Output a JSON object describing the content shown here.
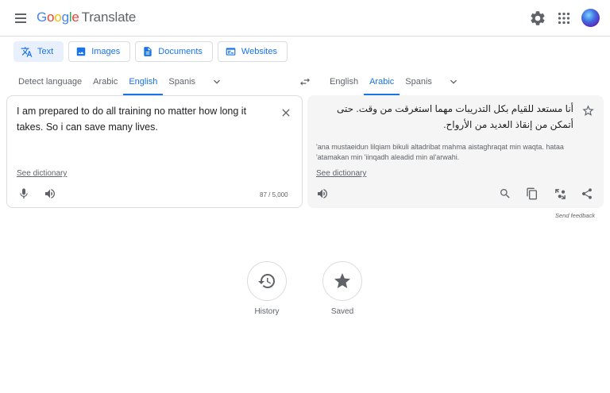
{
  "header": {
    "logo_google": "Google",
    "logo_product": "Translate",
    "colors": {
      "g_blue": "#4285f4",
      "o_red": "#ea4335",
      "o_yellow": "#fbbc05",
      "l_green": "#34a853"
    }
  },
  "modes": [
    {
      "label": "Text",
      "icon": "translate-icon",
      "active": true
    },
    {
      "label": "Images",
      "icon": "image-icon",
      "active": false
    },
    {
      "label": "Documents",
      "icon": "document-icon",
      "active": false
    },
    {
      "label": "Websites",
      "icon": "website-icon",
      "active": false
    }
  ],
  "source_languages": [
    "Detect language",
    "Arabic",
    "English",
    "Spanis"
  ],
  "source_active": "English",
  "target_languages": [
    "English",
    "Arabic",
    "Spanis"
  ],
  "target_active": "Arabic",
  "source": {
    "text": "I am prepared to do all training no matter how long it takes. So i can save many lives.",
    "see_dictionary": "See dictionary",
    "char_count": "87 / 5,000"
  },
  "target": {
    "text": "أنا مستعد للقيام بكل التدريبات مهما استغرقت من وقت. حتى أتمكن من إنقاذ العديد من الأرواح.",
    "transliteration": "'ana mustaeidun lilqiam bikuli altadribat mahma aistaghraqat min waqta. hataa 'atamakan min 'iinqadh aleadid min al'arwahi.",
    "see_dictionary": "See dictionary"
  },
  "send_feedback": "Send feedback",
  "bottom": {
    "history_label": "History",
    "saved_label": "Saved"
  },
  "accent": "#1a73e8"
}
